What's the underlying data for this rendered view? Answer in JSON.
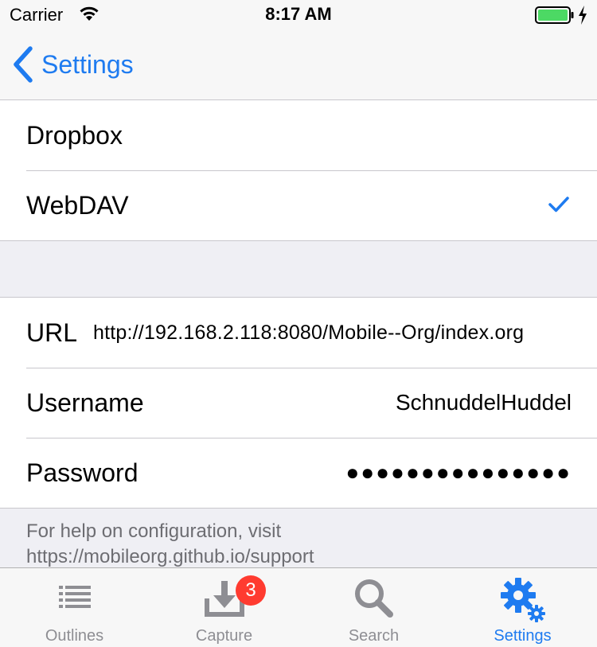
{
  "status_bar": {
    "carrier": "Carrier",
    "time": "8:17 AM"
  },
  "nav": {
    "back_label": "Settings"
  },
  "sync_options": [
    {
      "label": "Dropbox",
      "selected": false
    },
    {
      "label": "WebDAV",
      "selected": true
    }
  ],
  "webdav": {
    "url_label": "URL",
    "url_value": "http://192.168.2.118:8080/Mobile--Org/index.org",
    "username_label": "Username",
    "username_value": "SchnuddelHuddel",
    "password_label": "Password",
    "password_value": "●●●●●●●●●●●●●●●"
  },
  "footer": {
    "help_text": "For help on configuration, visit https://mobileorg.github.io/support"
  },
  "tabs": [
    {
      "label": "Outlines",
      "icon": "list-icon",
      "active": false
    },
    {
      "label": "Capture",
      "icon": "capture-icon",
      "active": false,
      "badge": "3"
    },
    {
      "label": "Search",
      "icon": "search-icon",
      "active": false
    },
    {
      "label": "Settings",
      "icon": "gear-icon",
      "active": true
    }
  ],
  "colors": {
    "accent": "#1e7bf0",
    "inactive": "#8e8e93",
    "badge": "#ff3b30",
    "battery": "#4cd964"
  }
}
